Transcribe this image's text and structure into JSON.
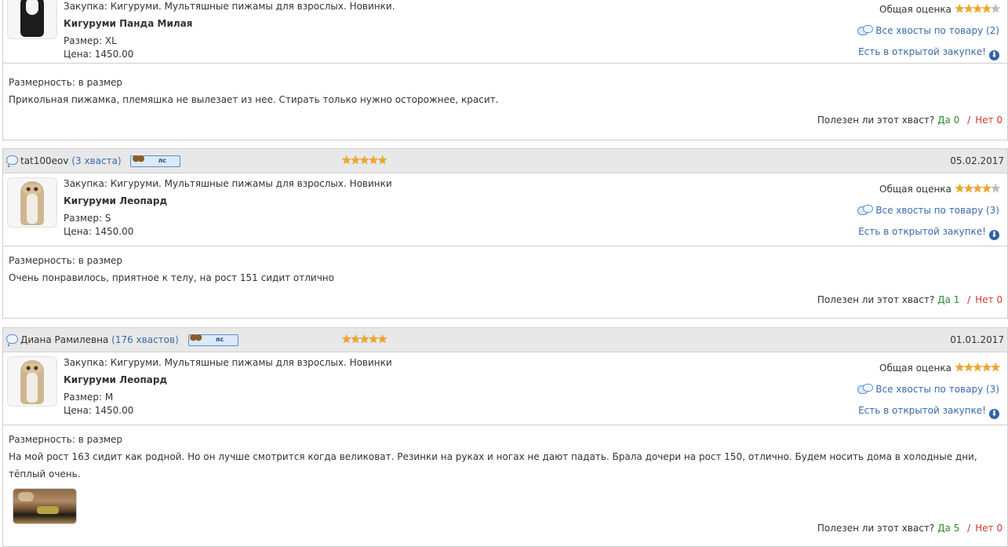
{
  "reviews": [
    {
      "first": true,
      "product": {
        "purchase": "Закупка: Кигуруми. Мультяшные пижамы для взрослых. Новинки.",
        "name": "Кигуруми Панда Милая",
        "size": "Размер: XL",
        "price": "Цена: 1450.00",
        "overall_label": "Общая оценка",
        "overall_rating": 4,
        "all_tails": "Все хвосты по товару (2)",
        "open_purchase": "Есть в открытой закупке!",
        "thumb": "panda"
      },
      "dim": "Размерность: в размер",
      "text": "Прикольная пижамка, племяшка не вылезает из нее. Стирать только нужно осторожнее, красит.",
      "useful_q": "Полезен ли этот хваст?",
      "yes": "Да 0",
      "sep": "/",
      "no": "Нет 0"
    },
    {
      "user": "tat100eov",
      "count": "(3 хваста)",
      "ls": "лс",
      "rating": 5,
      "date": "05.02.2017",
      "product": {
        "purchase": "Закупка: Кигуруми. Мультяшные пижамы для взрослых. Новинки",
        "name": "Кигуруми Леопард",
        "size": "Размер: S",
        "price": "Цена: 1450.00",
        "overall_label": "Общая оценка",
        "overall_rating": 4,
        "all_tails": "Все хвосты по товару (3)",
        "open_purchase": "Есть в открытой закупке!",
        "thumb": "leopard"
      },
      "dim": "Размерность: в размер",
      "text": "Очень понравилось, приятное к телу, на рост 151 сидит отлично",
      "useful_q": "Полезен ли этот хваст?",
      "yes": "Да 1",
      "sep": "/",
      "no": "Нет 0"
    },
    {
      "user": "Диана Рамилевна",
      "count": "(176 хвастов)",
      "ls": "лс",
      "rating": 5,
      "date": "01.01.2017",
      "product": {
        "purchase": "Закупка: Кигуруми. Мультяшные пижамы для взрослых. Новинки",
        "name": "Кигуруми Леопард",
        "size": "Размер: M",
        "price": "Цена: 1450.00",
        "overall_label": "Общая оценка",
        "overall_rating": 5,
        "all_tails": "Все хвосты по товару (3)",
        "open_purchase": "Есть в открытой закупке!",
        "thumb": "leopard"
      },
      "dim": "Размерность: в размер",
      "text": "На мой рост 163 сидит как родной. Но он лучше смотрится когда великоват. Резинки на руках и ногах не дают падать. Брала дочери на рост 150, отлично. Будем носить дома в холодные дни, тёплый очень.",
      "has_photo": true,
      "useful_q": "Полезен ли этот хваст?",
      "yes": "Да 5",
      "sep": "/",
      "no": "Нет 0"
    }
  ]
}
